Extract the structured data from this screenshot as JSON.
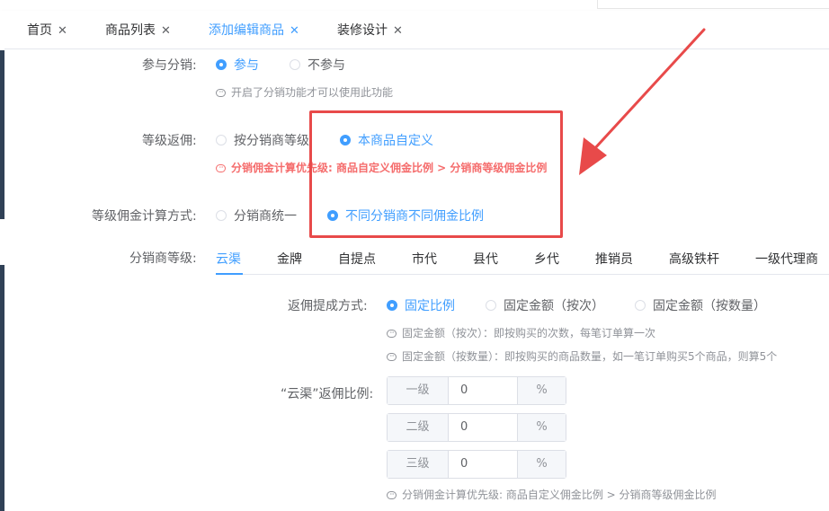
{
  "tabs": [
    {
      "label": "首页",
      "close": "✕"
    },
    {
      "label": "商品列表",
      "close": "✕"
    },
    {
      "label": "添加编辑商品",
      "close": "✕"
    },
    {
      "label": "装修设计",
      "close": "✕"
    }
  ],
  "participate": {
    "label": "参与分销:",
    "options": [
      "参与",
      "不参与"
    ],
    "hint": "开启了分销功能才可以使用此功能"
  },
  "level_rebate": {
    "label": "等级返佣:",
    "options": [
      "按分销商等级",
      "本商品自定义"
    ],
    "warning": "分销佣金计算优先级:  商品自定义佣金比例 > 分销商等级佣金比例"
  },
  "calc_method": {
    "label": "等级佣金计算方式:",
    "options": [
      "分销商统一",
      "不同分销商不同佣金比例"
    ]
  },
  "dist_levels": {
    "label": "分销商等级:",
    "tabs": [
      "云渠",
      "金牌",
      "自提点",
      "市代",
      "县代",
      "乡代",
      "推销员",
      "高级铁杆",
      "一级代理商"
    ]
  },
  "rebate_method": {
    "label": "返佣提成方式:",
    "options": [
      "固定比例",
      "固定金额（按次）",
      "固定金额（按数量）"
    ],
    "hints": [
      "固定金额（按次）：即按购买的次数，每笔订单算一次",
      "固定金额（按数量）：即按购买的商品数量，如一笔订单购买5个商品，则算5个"
    ]
  },
  "ratio": {
    "label": "“云渠”返佣比例:",
    "rows": [
      {
        "level": "一级",
        "value": "0",
        "unit": "%"
      },
      {
        "level": "二级",
        "value": "0",
        "unit": "%"
      },
      {
        "level": "三级",
        "value": "0",
        "unit": "%"
      }
    ],
    "hint": "分销佣金计算优先级:  商品自定义佣金比例 > 分销商等级佣金比例"
  },
  "colors": {
    "accent": "#409eff",
    "annotation": "#e84a4a",
    "warning": "#f56c6c"
  }
}
